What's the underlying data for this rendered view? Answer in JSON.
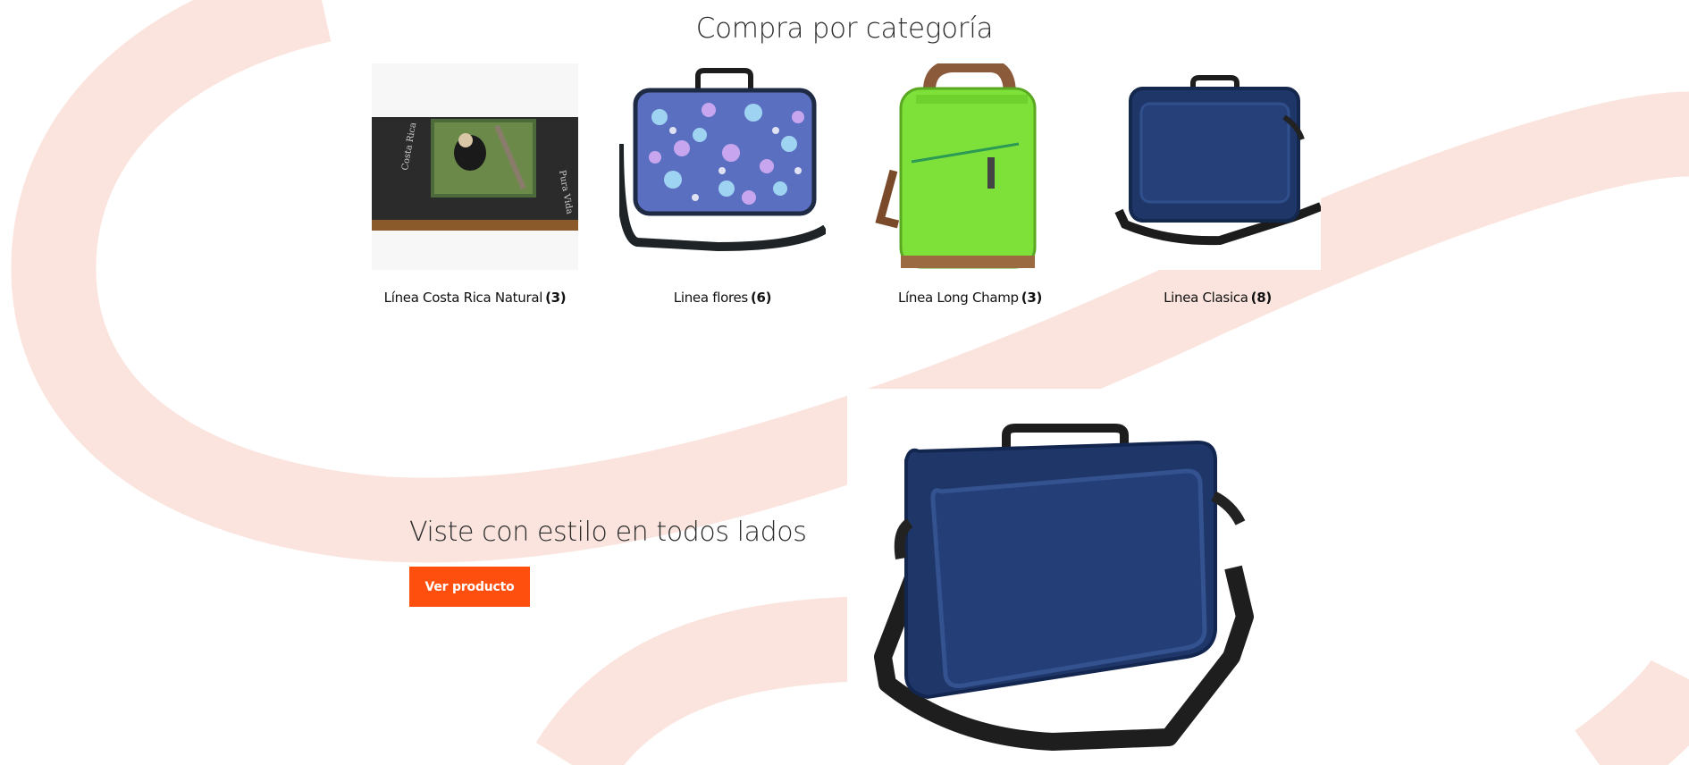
{
  "colors": {
    "accent": "#ff4f0f",
    "decor": "#fbe4de"
  },
  "section": {
    "title": "Compra por categoría"
  },
  "categories": [
    {
      "name": "Línea Costa Rica Natural",
      "count": "(3)",
      "image": "costa-rica-wallet-image"
    },
    {
      "name": "Linea flores",
      "count": "(6)",
      "image": "floral-laptop-bag-image"
    },
    {
      "name": "Línea Long Champ",
      "count": "(3)",
      "image": "green-backpack-image"
    },
    {
      "name": "Linea Clasica",
      "count": "(8)",
      "image": "navy-laptop-bag-image"
    }
  ],
  "hero": {
    "title": "Viste con estilo en todos lados",
    "button_label": "Ver producto",
    "image": "navy-laptop-bag-image"
  }
}
